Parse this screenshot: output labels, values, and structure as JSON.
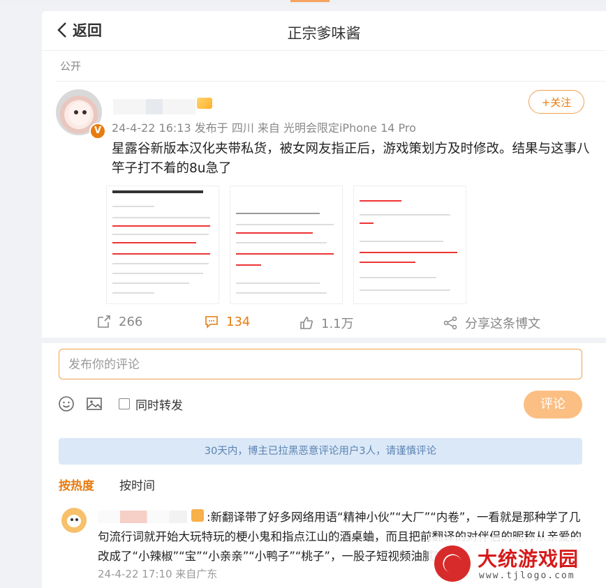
{
  "header": {
    "back_label": "返回",
    "title": "正宗爹味酱"
  },
  "post": {
    "visibility": "公开",
    "follow_label": "+关注",
    "meta": "24-4-22 16:13  发布于 四川  来自 光明会限定iPhone 14 Pro",
    "text": "星露谷新版本汉化夹带私货，被女网友指正后，游戏策划方及时修改。结果与这事八竿子打不着的8u急了",
    "verified_mark": "V",
    "images": [
      "image-1",
      "image-2",
      "image-3"
    ],
    "actions": {
      "reposts": "266",
      "comments": "134",
      "likes": "1.1万",
      "share_label": "分享这条博文"
    }
  },
  "comment_box": {
    "placeholder": "发布你的评论",
    "repost_label": "同时转发",
    "submit_label": "评论"
  },
  "notice": "30天内，博主已拉黑恶意评论用户3人，请谨慎评论",
  "sort": {
    "hot": "按热度",
    "time": "按时间"
  },
  "comments": [
    {
      "text": ":新翻译带了好多网络用语“精神小伙”“大厂”“内卷”，一看就是那种学了几句流行词就开始大玩特玩的梗小鬼和指点江山的酒桌蛐，而且把前翻译的对伴侣的昵称从亲爱的改成了“小辣椒”“宝”“小亲亲”“小鸭子”“桃子”，一股子短视频油腻味，唉",
      "meta": "24-4-22 17:10  来自广东"
    }
  ],
  "watermark": {
    "brand": "大统游戏园",
    "url": "www.tjlogo.com"
  },
  "colors": {
    "accent": "#e77c0f",
    "notice_bg": "#dbe8f7",
    "notice_text": "#5b83b2",
    "submit_bg": "#fbbf83"
  }
}
